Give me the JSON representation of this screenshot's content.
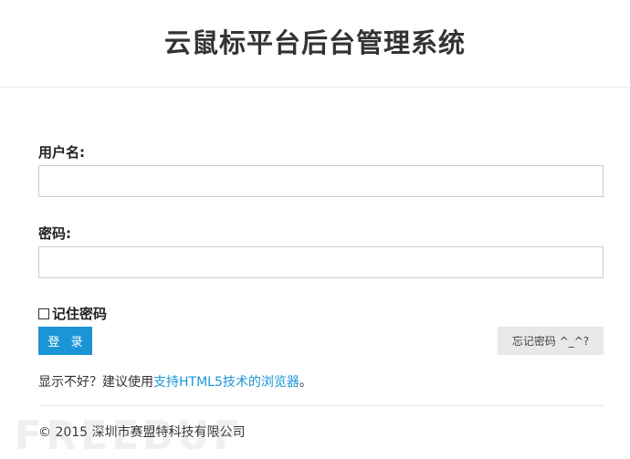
{
  "header": {
    "title": "云鼠标平台后台管理系统"
  },
  "form": {
    "username_label": "用户名:",
    "username_value": "",
    "password_label": "密码:",
    "password_value": "",
    "remember_label": "记住密码",
    "login_label": "登 录",
    "forgot_label": "忘记密码 ^_^?"
  },
  "note": {
    "prefix": "显示不好？建议使用",
    "link": "支持HTML5技术的浏览器",
    "suffix": "。"
  },
  "footer": {
    "copyright": "© 2015 深圳市赛盟特科技有限公司"
  },
  "watermark": {
    "text": "FREEBUF"
  },
  "colors": {
    "accent": "#1b95d6",
    "secondary_button": "#e8e8e8"
  }
}
